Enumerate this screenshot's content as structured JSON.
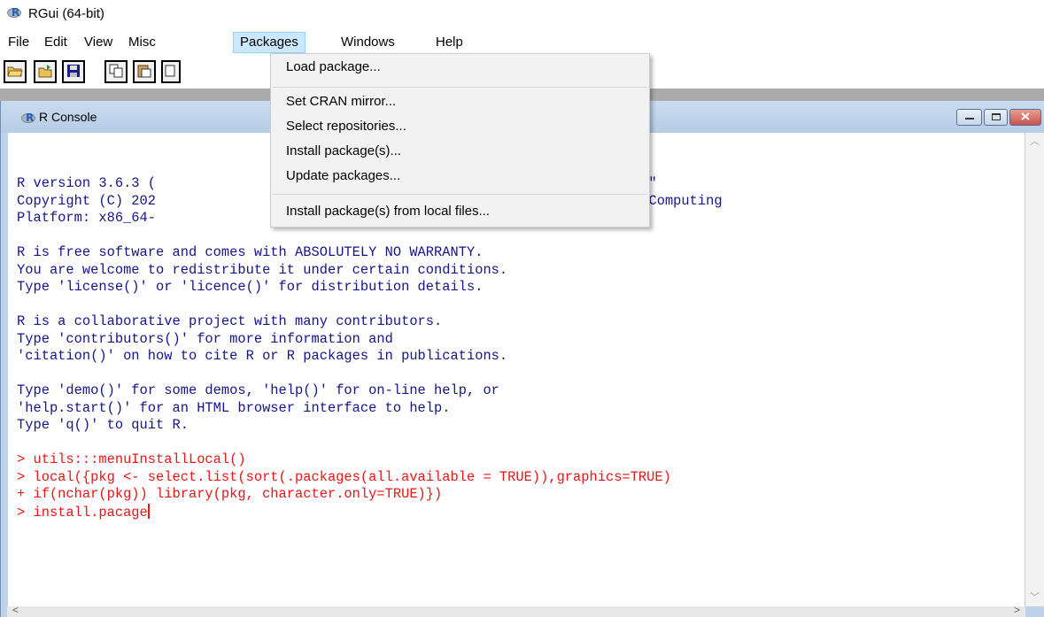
{
  "window": {
    "title": "RGui (64-bit)",
    "icon": "r-logo-icon"
  },
  "menubar": {
    "items": [
      {
        "label": "File"
      },
      {
        "label": "Edit"
      },
      {
        "label": "View"
      },
      {
        "label": "Misc"
      },
      {
        "label": "Packages",
        "active": true
      },
      {
        "label": "Windows"
      },
      {
        "label": "Help"
      }
    ]
  },
  "toolbar": {
    "buttons": [
      {
        "icon": "open-folder-icon"
      },
      {
        "icon": "load-workspace-icon"
      },
      {
        "icon": "save-icon"
      },
      {
        "icon": "copy-icon"
      },
      {
        "icon": "paste-icon"
      },
      {
        "icon": "copy-paste-icon"
      }
    ]
  },
  "packages_menu": {
    "items": [
      {
        "label": "Load package..."
      },
      {
        "label": "Set CRAN mirror..."
      },
      {
        "label": "Select repositories..."
      },
      {
        "label": "Install package(s)..."
      },
      {
        "label": "Update packages..."
      },
      {
        "label": "Install package(s) from local files..."
      }
    ]
  },
  "console": {
    "title": "R Console",
    "lines": [
      {
        "text": "R version 3.6.3 (",
        "type": "out"
      },
      {
        "text": "Copyright (C) 202",
        "type": "out"
      },
      {
        "text": "Platform: x86_64-",
        "type": "out"
      },
      {
        "text": "",
        "type": "out"
      },
      {
        "text": "R is free software and comes with ABSOLUTELY NO WARRANTY.",
        "type": "out"
      },
      {
        "text": "You are welcome to redistribute it under certain conditions.",
        "type": "out"
      },
      {
        "text": "Type 'license()' or 'licence()' for distribution details.",
        "type": "out"
      },
      {
        "text": "",
        "type": "out"
      },
      {
        "text": "R is a collaborative project with many contributors.",
        "type": "out"
      },
      {
        "text": "Type 'contributors()' for more information and",
        "type": "out"
      },
      {
        "text": "'citation()' on how to cite R or R packages in publications.",
        "type": "out"
      },
      {
        "text": "",
        "type": "out"
      },
      {
        "text": "Type 'demo()' for some demos, 'help()' for on-line help, or",
        "type": "out"
      },
      {
        "text": "'help.start()' for an HTML browser interface to help.",
        "type": "out"
      },
      {
        "text": "Type 'q()' to quit R.",
        "type": "out"
      },
      {
        "text": "",
        "type": "out"
      },
      {
        "text": "> utils:::menuInstallLocal()",
        "type": "in"
      },
      {
        "text": "> local({pkg <- select.list(sort(.packages(all.available = TRUE)),graphics=TRUE)",
        "type": "in"
      },
      {
        "text": "+ if(nchar(pkg)) library(pkg, character.only=TRUE)})",
        "type": "in"
      },
      {
        "text": "> install.pacage",
        "type": "in",
        "cursor": true
      }
    ],
    "hidden_fragments": [
      {
        "text": "ck\""
      },
      {
        "text": "l Computing"
      }
    ]
  }
}
